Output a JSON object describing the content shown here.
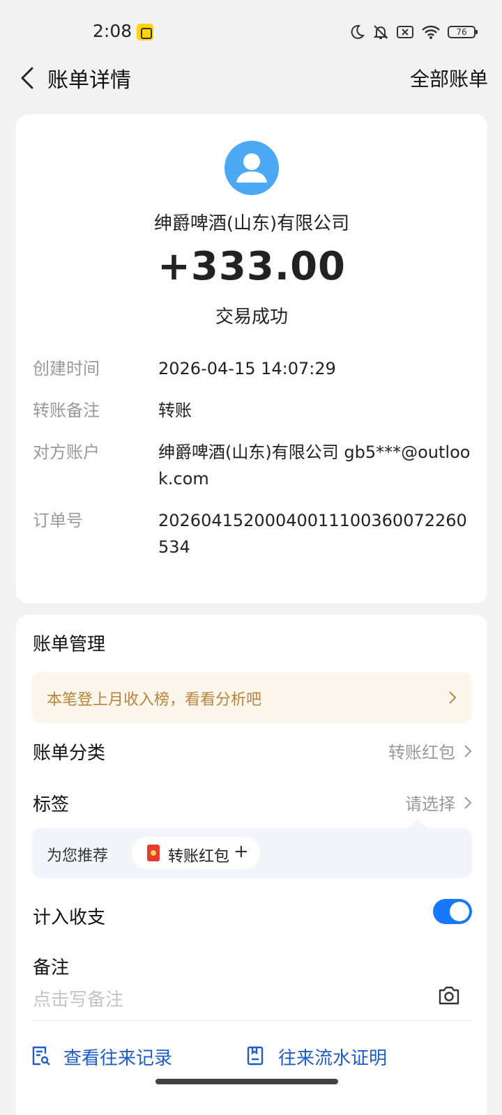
{
  "status_bar": {
    "time": "2:08",
    "battery": "76"
  },
  "header": {
    "title": "账单详情",
    "right_action": "全部账单"
  },
  "transaction": {
    "company": "绅爵啤酒(山东)有限公司",
    "amount": "+333.00",
    "status": "交易成功",
    "details": [
      {
        "label": "创建时间",
        "value": "2026-04-15 14:07:29"
      },
      {
        "label": "转账备注",
        "value": "转账"
      },
      {
        "label": "对方账户",
        "value": "绅爵啤酒(山东)有限公司 gb5***@outlook.com"
      },
      {
        "label": "订单号",
        "value": "20260415200040011100360072260534"
      }
    ]
  },
  "management": {
    "title": "账单管理",
    "banner": "本笔登上月收入榜，看看分析吧",
    "category_label": "账单分类",
    "category_value": "转账红包",
    "tag_label": "标签",
    "tag_value": "请选择",
    "recommend_label": "为您推荐",
    "recommend_chip": "转账红包",
    "count_label": "计入收支",
    "count_enabled": true,
    "note_label": "备注",
    "note_placeholder": "点击写备注",
    "link_records": "查看往来记录",
    "link_proof": "往来流水证明"
  },
  "icons": [
    "back-arrow-icon",
    "moon-icon",
    "bell-off-icon",
    "sim-off-icon",
    "wifi-icon",
    "battery-icon",
    "user-avatar-icon",
    "chevron-right-icon",
    "red-packet-icon",
    "plus-icon",
    "camera-icon",
    "record-search-icon",
    "document-icon"
  ],
  "colors": {
    "accent_blue": "#1677ff",
    "link_blue": "#1f5cc8",
    "banner_text": "#b9833a",
    "avatar_blue": "#4aa8f4"
  }
}
